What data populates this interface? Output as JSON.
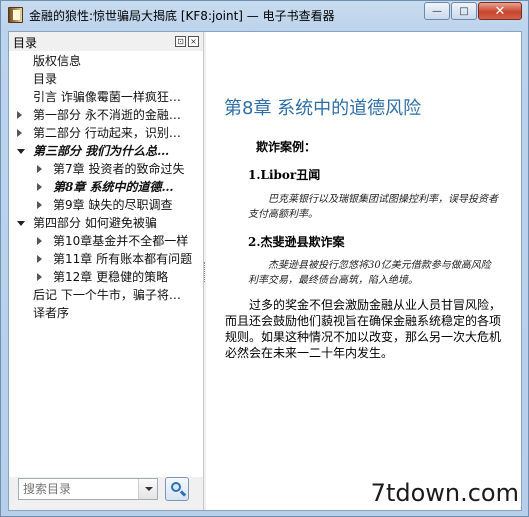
{
  "window": {
    "title": "金融的狼性:惊世骗局大揭底 [KF8:joint] — 电子书查看器",
    "minimize_glyph": "—",
    "maximize_glyph": "□",
    "close_glyph": "✕"
  },
  "sidebar": {
    "title": "目录",
    "float_glyph": "⊡",
    "close_glyph": "×",
    "items": [
      {
        "label": "版权信息",
        "level": 0,
        "arrow": "none"
      },
      {
        "label": "目录",
        "level": 0,
        "arrow": "none"
      },
      {
        "label": "引言  诈骗像霉菌一样疯狂…",
        "level": 0,
        "arrow": "none"
      },
      {
        "label": "第一部分  永不消逝的金融…",
        "level": 0,
        "arrow": "right"
      },
      {
        "label": "第二部分  行动起来，识别…",
        "level": 0,
        "arrow": "right"
      },
      {
        "label": "第三部分  我们为什么总…",
        "level": 0,
        "arrow": "down",
        "bold": true
      },
      {
        "label": "第7章  投资者的致命过失",
        "level": 1,
        "arrow": "right"
      },
      {
        "label": "第8章  系统中的道德…",
        "level": 1,
        "arrow": "right",
        "bold": true
      },
      {
        "label": "第9章  缺失的尽职调查",
        "level": 1,
        "arrow": "right"
      },
      {
        "label": "第四部分  如何避免被骗",
        "level": 0,
        "arrow": "down"
      },
      {
        "label": "第10章基金并不全都一样",
        "level": 1,
        "arrow": "right"
      },
      {
        "label": "第11章  所有账本都有问题",
        "level": 1,
        "arrow": "right"
      },
      {
        "label": "第12章  更稳健的策略",
        "level": 1,
        "arrow": "right"
      },
      {
        "label": "后记  下一个牛市，骗子将…",
        "level": 0,
        "arrow": "none"
      },
      {
        "label": "译者序",
        "level": 0,
        "arrow": "none"
      }
    ],
    "search": {
      "placeholder": "搜索目录"
    }
  },
  "content": {
    "chapter_title": "第8章    系统中的道德风险",
    "case_heading": "欺诈案例：",
    "case1_title": "1.Libor丑闻",
    "case1_quote": "巴克莱银行以及瑞银集团试图操控利率，误导投资者支付高额利率。",
    "case2_title": "2.杰斐逊县欺诈案",
    "case2_quote": "杰斐逊县被投行忽悠将30亿美元借款参与做高风险利率交易，最终债台高筑，陷入绝境。",
    "paragraph": "过多的奖金不但会激励金融从业人员甘冒风险，而且还会鼓励他们藐视旨在确保金融系统稳定的各项规则。如果这种情况不加以改变，那么另一次大危机必然会在未来一二十年内发生。"
  },
  "watermark": "7tdown.com"
}
